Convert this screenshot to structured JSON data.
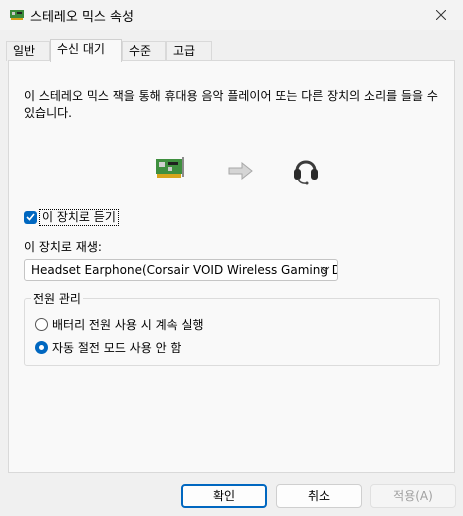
{
  "window": {
    "title": "스테레오 믹스 속성"
  },
  "tabs": [
    {
      "label": "일반"
    },
    {
      "label": "수신 대기"
    },
    {
      "label": "수준"
    },
    {
      "label": "고급"
    }
  ],
  "listen": {
    "description": "이 스테레오 믹스 잭을 통해 휴대용 음악 플레이어 또는 다른 장치의 소리를 들을 수 있습니다.",
    "checkbox_label": "이 장치로 듣기",
    "checkbox_checked": true,
    "playback_label": "이 장치로 재생:",
    "playback_value": "Headset Earphone(Corsair VOID Wireless Gaming Dongle)",
    "icons": [
      "sound-card-icon",
      "arrow-right-icon",
      "headset-icon"
    ]
  },
  "power": {
    "group_label": "전원 관리",
    "options": [
      {
        "label": "배터리 전원 사용 시 계속 실행",
        "selected": false
      },
      {
        "label": "자동 절전 모드 사용 안 함",
        "selected": true
      }
    ]
  },
  "buttons": {
    "ok": "확인",
    "cancel": "취소",
    "apply": "적용(A)"
  },
  "colors": {
    "accent": "#0067c0"
  }
}
